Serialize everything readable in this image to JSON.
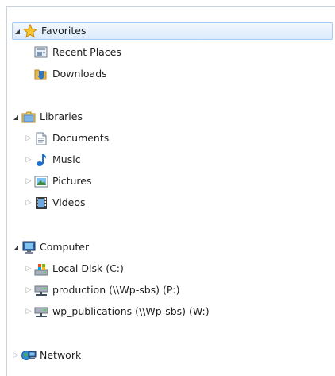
{
  "tree": {
    "favorites": {
      "label": "Favorites",
      "items": [
        {
          "label": "Recent Places",
          "icon": "recent-places-icon"
        },
        {
          "label": "Downloads",
          "icon": "downloads-folder-icon"
        }
      ]
    },
    "libraries": {
      "label": "Libraries",
      "items": [
        {
          "label": "Documents",
          "icon": "documents-icon"
        },
        {
          "label": "Music",
          "icon": "music-icon"
        },
        {
          "label": "Pictures",
          "icon": "pictures-icon"
        },
        {
          "label": "Videos",
          "icon": "videos-icon"
        }
      ]
    },
    "computer": {
      "label": "Computer",
      "items": [
        {
          "label": "Local Disk (C:)",
          "icon": "local-disk-icon"
        },
        {
          "label": "production (\\\\Wp-sbs) (P:)",
          "icon": "network-drive-icon"
        },
        {
          "label": "wp_publications (\\\\Wp-sbs) (W:)",
          "icon": "network-drive-icon"
        }
      ]
    },
    "network": {
      "label": "Network"
    }
  },
  "colors": {
    "selection_fill": "#dbeafb",
    "selection_border": "#a7cbf4",
    "pane_border": "#c9d3de"
  }
}
